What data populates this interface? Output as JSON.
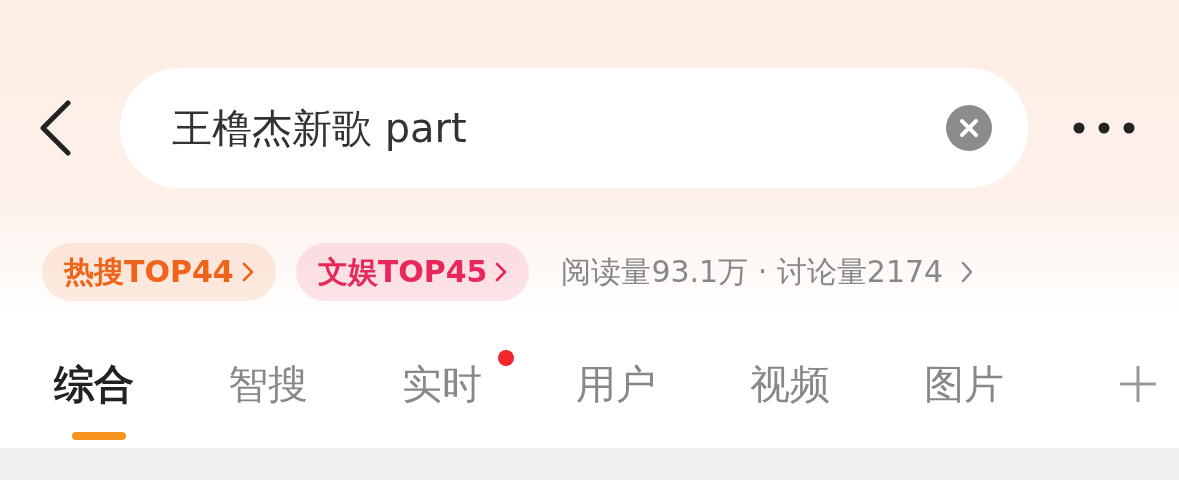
{
  "search": {
    "value": "王橹杰新歌 part"
  },
  "badges": [
    {
      "label": "热搜TOP44",
      "color": "#f0631a"
    },
    {
      "label": "文娱TOP45",
      "color": "#e8275a"
    }
  ],
  "stats": "阅读量93.1万 · 讨论量2174",
  "tabs": [
    {
      "label": "综合",
      "selected": true,
      "dot": false
    },
    {
      "label": "智搜",
      "selected": false,
      "dot": false
    },
    {
      "label": "实时",
      "selected": false,
      "dot": true
    },
    {
      "label": "用户",
      "selected": false,
      "dot": false
    },
    {
      "label": "视频",
      "selected": false,
      "dot": false
    },
    {
      "label": "图片",
      "selected": false,
      "dot": false
    }
  ]
}
